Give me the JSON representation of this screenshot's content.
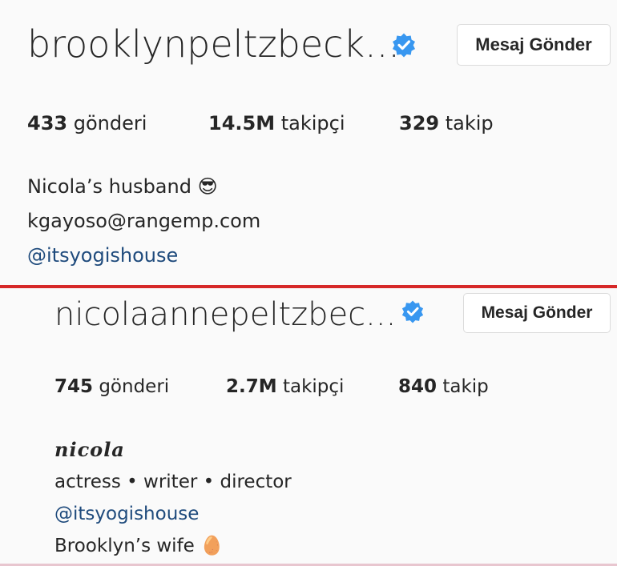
{
  "profiles": [
    {
      "username": "brooklynpeltzbeck...",
      "message_button": "Mesaj Gönder",
      "verified_icon": "verified-badge-icon",
      "stats": {
        "posts_value": "433",
        "posts_label": "gönderi",
        "followers_value": "14.5M",
        "followers_label": "takipçi",
        "following_value": "329",
        "following_label": "takip"
      },
      "bio": {
        "line1": "Nicola’s husband 😎",
        "line2": "kgayoso@rangemp.com",
        "line3": "@itsyogishouse"
      }
    },
    {
      "username": "nicolaannepeltzbec...",
      "message_button": "Mesaj Gönder",
      "verified_icon": "verified-badge-icon",
      "stats": {
        "posts_value": "745",
        "posts_label": "gönderi",
        "followers_value": "2.7M",
        "followers_label": "takipçi",
        "following_value": "840",
        "following_label": "takip"
      },
      "bio": {
        "name": "𝒏𝒊𝒄𝒐𝒍𝒂",
        "line1": "actress • writer • director",
        "line2": "@itsyogishouse",
        "line3": "Brooklyn’s wife 🥚"
      }
    }
  ],
  "colors": {
    "divider": "#d62828",
    "verified": "#3897f0",
    "link": "#1e4a7c"
  }
}
